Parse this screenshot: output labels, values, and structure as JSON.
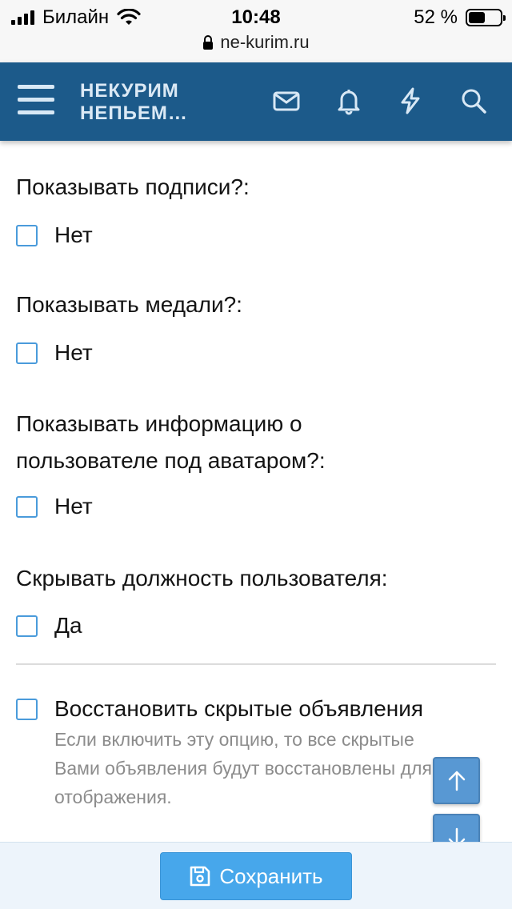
{
  "status_bar": {
    "carrier": "Билайн",
    "time": "10:48",
    "battery_percent_text": "52 %",
    "battery_level": 0.52,
    "url": "ne-kurim.ru"
  },
  "header": {
    "logo_line1": "НЕКУРИМ",
    "logo_line2": "НЕПЬЕМ…",
    "icons": [
      "menu-icon",
      "mail-icon",
      "bell-icon",
      "lightning-icon",
      "search-icon"
    ],
    "color": "#1c5a8a"
  },
  "settings": [
    {
      "label": "Показывать подписи?:",
      "option": "Нет",
      "checked": false
    },
    {
      "label": "Показывать медали?:",
      "option": "Нет",
      "checked": false
    },
    {
      "label_line1": "Показывать информацию о",
      "label_line2": "пользователе под аватаром?:",
      "option": "Нет",
      "checked": false
    },
    {
      "label": "Скрывать должность пользователя:",
      "option": "Да",
      "checked": false
    }
  ],
  "restore": {
    "option": "Восстановить скрытые объявления",
    "hint_line1": "Если включить эту опцию, то все скрытые",
    "hint_line2": "Вами объявления будут восстановлены для",
    "hint_line3": "отображения.",
    "checked": false
  },
  "footer": {
    "save_label": "Сохранить"
  },
  "colors": {
    "accent": "#47a7eb",
    "checkbox_border": "#4a9bdb"
  }
}
